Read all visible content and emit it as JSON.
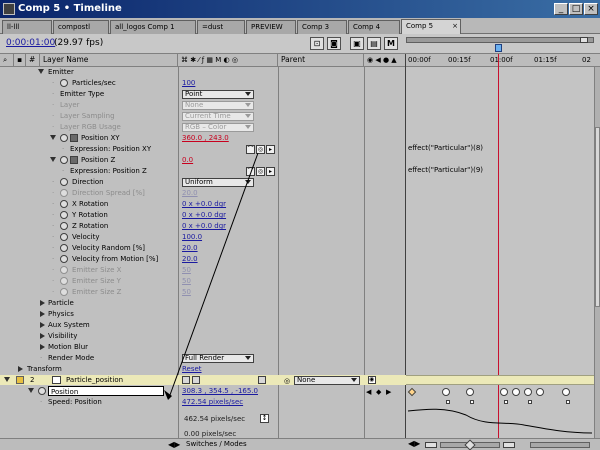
{
  "window": {
    "title": "Comp 5 • Timeline",
    "min": "_",
    "max": "□",
    "close": "×"
  },
  "tabs": [
    {
      "label": "ll-lll"
    },
    {
      "label": "compostl"
    },
    {
      "label": "all_logos Comp 1"
    },
    {
      "label": "=dust"
    },
    {
      "label": "PREVIEW"
    },
    {
      "label": "Comp 3"
    },
    {
      "label": "Comp 4"
    },
    {
      "label": "Comp 5"
    }
  ],
  "toolbar": {
    "timecode": "0:00:01:00",
    "fps": "(29.97 fps)"
  },
  "headers": {
    "layer_name": "Layer Name",
    "parent": "Parent",
    "hash": "#"
  },
  "ruler": {
    "ticks": [
      "00:00f",
      "00:15f",
      "01:00f",
      "01:15f",
      "02"
    ]
  },
  "rows": [
    {
      "label": "Emitter"
    },
    {
      "label": "Particles/sec",
      "value": "100"
    },
    {
      "label": "Emitter Type",
      "value": "Point"
    },
    {
      "label": "Layer",
      "value": "None"
    },
    {
      "label": "Layer Sampling",
      "value": "Current Time"
    },
    {
      "label": "Layer RGB Usage",
      "value": "RGB – Color"
    },
    {
      "label": "Position XY",
      "value": "360.0 , 243.0"
    },
    {
      "label": "Expression: Position XY"
    },
    {
      "label": "Position Z",
      "value": "0.0"
    },
    {
      "label": "Expression: Position Z"
    },
    {
      "label": "Direction",
      "value": "Uniform"
    },
    {
      "label": "Direction Spread [%]",
      "value": "20.0"
    },
    {
      "label": "X Rotation",
      "value": "0 x +0.0 dgr"
    },
    {
      "label": "Y Rotation",
      "value": "0 x +0.0 dgr"
    },
    {
      "label": "Z Rotation",
      "value": "0 x +0.0 dgr"
    },
    {
      "label": "Velocity",
      "value": "100.0"
    },
    {
      "label": "Velocity Random [%]",
      "value": "20.0"
    },
    {
      "label": "Velocity from Motion [%]",
      "value": "20.0"
    },
    {
      "label": "Emitter Size X",
      "value": "50"
    },
    {
      "label": "Emitter Size Y",
      "value": "50"
    },
    {
      "label": "Emitter Size Z",
      "value": "50"
    },
    {
      "label": "Particle"
    },
    {
      "label": "Physics"
    },
    {
      "label": "Aux System"
    },
    {
      "label": "Visibility"
    },
    {
      "label": "Motion Blur"
    },
    {
      "label": "Render Mode",
      "value": "Full Render"
    },
    {
      "label": "Transform",
      "value": "Reset"
    },
    {
      "label": "2",
      "value": "Particle_position"
    },
    {
      "label": "Position",
      "value": "308.3 , 354.5 , -165.0"
    },
    {
      "label": "Speed: Position",
      "value": "472.54 pixels/sec"
    },
    {
      "label": "",
      "value": "462.54 pixels/sec"
    },
    {
      "label": "",
      "value": "0.00 pixels/sec"
    }
  ],
  "expressions": {
    "xy": "effect(\"Particular\")(8)",
    "z": "effect(\"Particular\")(9)"
  },
  "parent": {
    "value": "None"
  },
  "bottom": {
    "switches": "Switches / Modes"
  }
}
